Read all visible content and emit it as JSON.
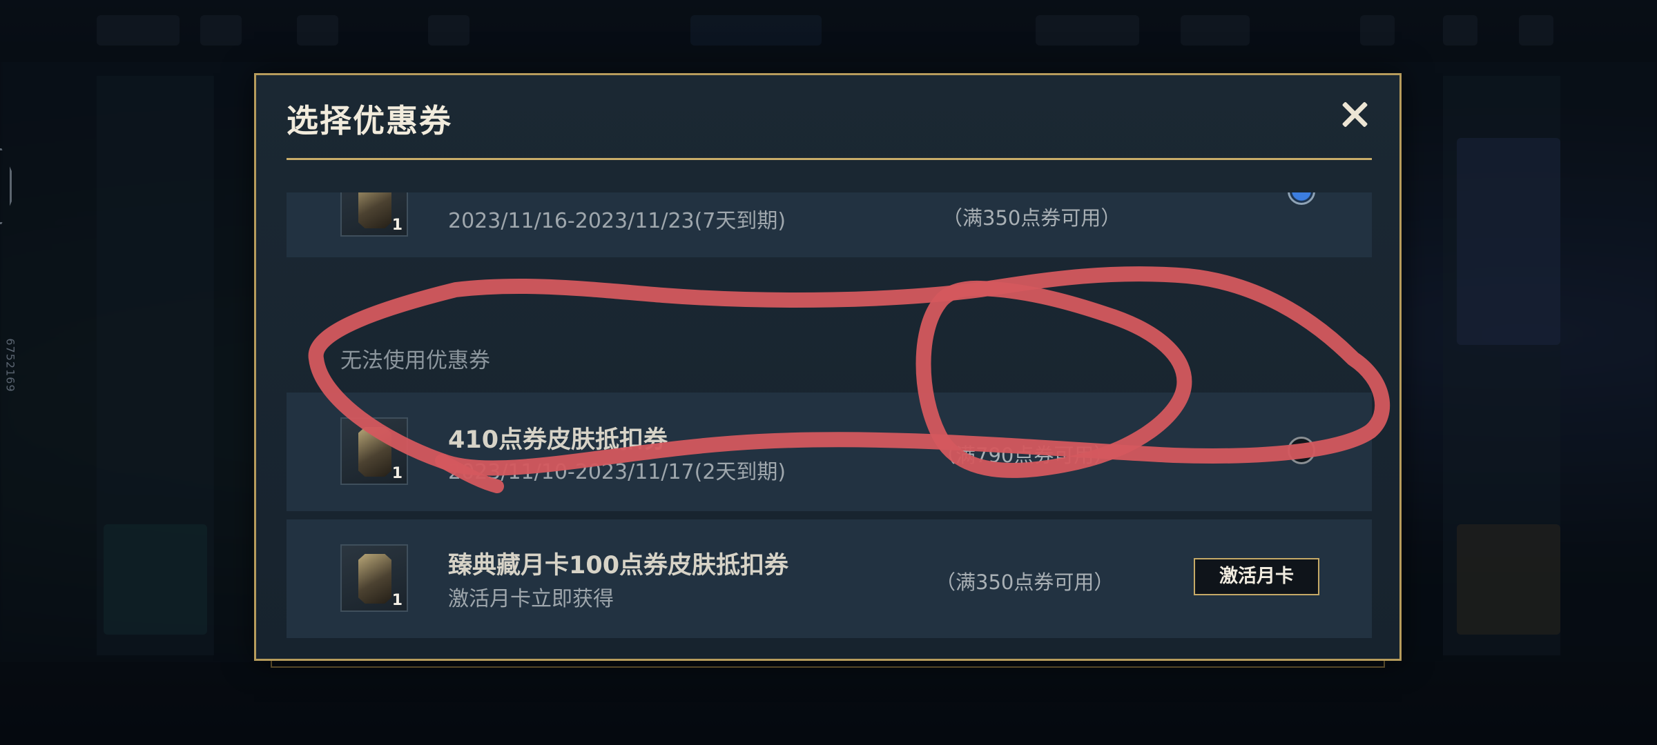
{
  "colors": {
    "accent_gold": "#c9ad6a",
    "annotation_red": "#d4585e",
    "radio_selected": "#3c7ee0"
  },
  "background": {
    "side_id": "6752169"
  },
  "dialog": {
    "title": "选择优惠券",
    "close_icon": "close-icon"
  },
  "coupons": [
    {
      "name": "",
      "quantity": "1",
      "validity": "2023/11/16-2023/11/23(7天到期)",
      "condition": "（满350点券可用）",
      "selected": true
    }
  ],
  "unusable_section": {
    "label": "无法使用优惠券",
    "items": [
      {
        "name": "410点券皮肤抵扣券",
        "quantity": "1",
        "validity": "2023/11/10-2023/11/17(2天到期)",
        "condition": "（满790点券可用）",
        "selected": false
      },
      {
        "name": "臻典藏月卡100点券皮肤抵扣券",
        "quantity": "1",
        "subtitle": "激活月卡立即获得",
        "condition": "（满350点券可用）",
        "action_label": "激活月卡"
      }
    ]
  }
}
